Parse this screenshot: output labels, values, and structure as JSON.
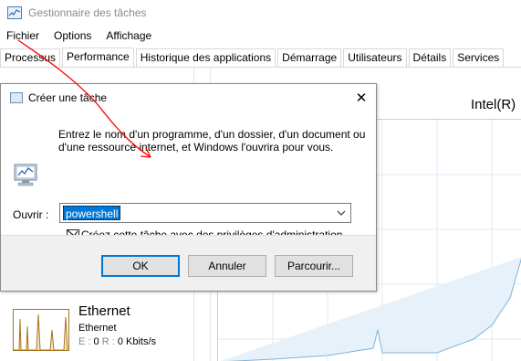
{
  "task_manager": {
    "title": "Gestionnaire des tâches",
    "menu": [
      "Fichier",
      "Options",
      "Affichage"
    ],
    "tabs": [
      "Processus",
      "Performance",
      "Historique des applications",
      "Démarrage",
      "Utilisateurs",
      "Détails",
      "Services"
    ],
    "active_tab": "Performance",
    "cpu_label": "Intel(R)",
    "ethernet": {
      "title": "Ethernet",
      "subtitle": "Ethernet",
      "stats_e_label": "E :",
      "stats_e_value": "0",
      "stats_r_label": "R :",
      "stats_r_value": "0 Kbits/s"
    }
  },
  "run_dialog": {
    "title": "Créer une tâche",
    "description": "Entrez le nom d'un programme, d'un dossier, d'un document ou d'une ressource internet, et Windows l'ouvrira pour vous.",
    "open_label": "Ouvrir :",
    "open_value": "powershell",
    "admin_label": "Créez cette tâche avec des privilèges d'administration.",
    "admin_checked": true,
    "ok_label": "OK",
    "cancel_label": "Annuler",
    "browse_label": "Parcourir..."
  },
  "icons": {
    "app": "task-manager-icon",
    "run": "run-program-icon",
    "close": "close-icon",
    "dropdown": "chevron-down-icon",
    "admin_shield": "admin-checkbox-icon"
  },
  "colors": {
    "selection": "#0078d7",
    "annotation": "#ff0000",
    "graph_line": "#7fb4d8",
    "ethernet_graph": "#a67418"
  }
}
